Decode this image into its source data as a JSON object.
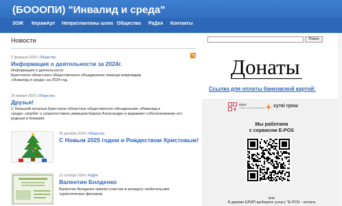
{
  "header": {
    "title": "(БОООПИ) \"Инвалид и среда\""
  },
  "nav": {
    "items": [
      "ЗОЖ",
      "КерамАрт",
      "Непратлантаны шлях",
      "Общество",
      "РаДея",
      "Контакты"
    ]
  },
  "main": {
    "section_title": "Новости",
    "posts": [
      {
        "date": "2 февраля 2025",
        "separator": "|",
        "category": "Общество",
        "title": "Информация о деятельности за 2024г.",
        "text_lines": [
          "Информация о деятельности",
          "Брестского областного общественного объединения помощи инвалидам",
          "«Инвалид и среда» за 2024 год."
        ]
      },
      {
        "date": "26 января 2025",
        "separator": "|",
        "category": "Общество",
        "title": "Друзья!",
        "text_lines": [
          "С большой печалью Брестское областное общественное объединение «Инвалид и",
          "среда» скорбит о скоропостижно умершем  Карлук Александре и выражает соболезнование его",
          "родным и близким."
        ]
      },
      {
        "date": "25 декабря 2024",
        "separator": "|",
        "category": "Общество",
        "title": "С Новым 2025 годом и Рождеством Христовым!",
        "text_lines": []
      },
      {
        "date": "15 октября 2024",
        "separator": "|",
        "category": "РаДея",
        "title": "Валентин Болденко",
        "text_lines": [
          "Валентин Болденко принял участие в конкурсе любительских",
          "туристических фильмов."
        ]
      }
    ]
  },
  "sidebar": {
    "search_placeholder": "",
    "search_button": "Поиск",
    "donate_title": "Донаты",
    "donate_link": "Ссылка для оплаты банковской картой:",
    "epos": {
      "brand": "epos",
      "brand_sub": "сервис от Білгазпромбанка",
      "partner": "хуткі грош",
      "line1": "Мы работаем",
      "line2": "с сервисом E-POS",
      "or": "или",
      "bottom": "В дереве ЕРИП выберите услугу \"E-POS - оплата"
    }
  },
  "colors": {
    "header_blue": "#2a64b4",
    "link_blue": "#2a64b4",
    "rss_orange": "#f28a1b",
    "hutki_orange": "#f47a20"
  }
}
